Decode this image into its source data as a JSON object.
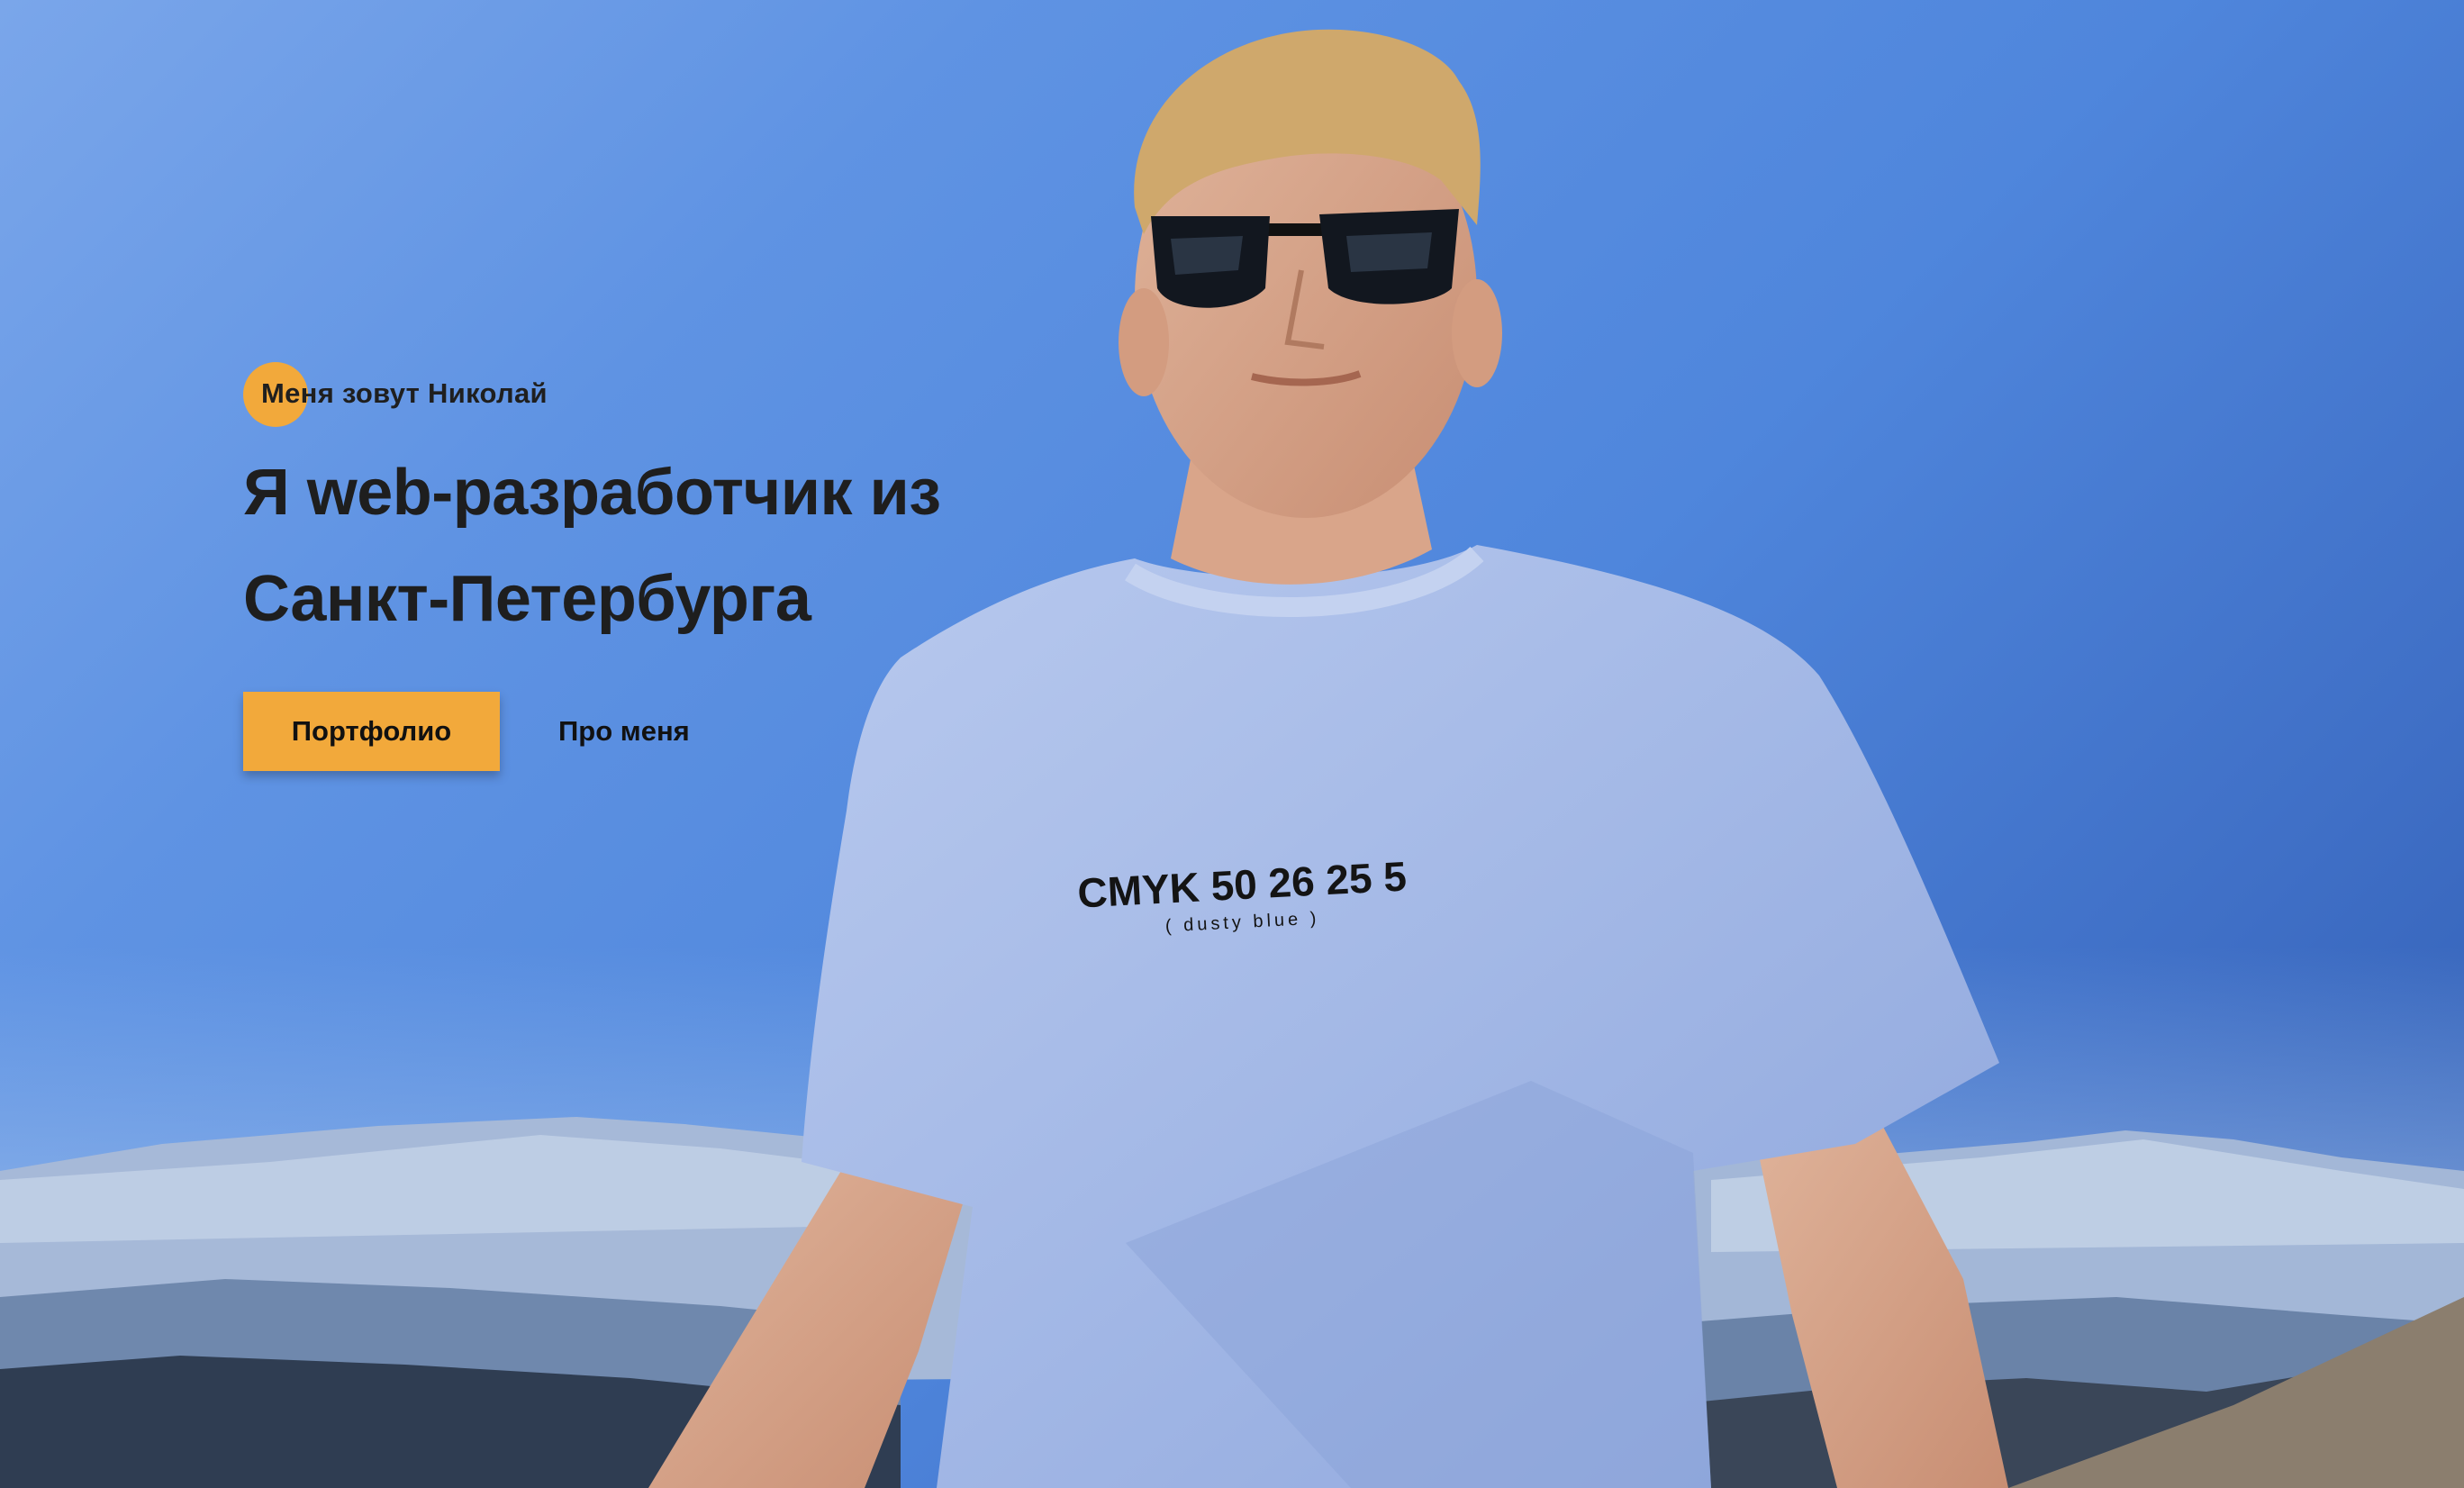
{
  "hero": {
    "eyebrow": "Меня зовут Николай",
    "headline_line1": "Я web-разработчик из",
    "headline_line2": "Санкт-Петербурга",
    "primary_button": "Портфолио",
    "secondary_link": "Про меня",
    "shirt_print_main": "CMYK 50 26 25 5",
    "shirt_print_sub": "( dusty blue )"
  },
  "colors": {
    "accent": "#f2a93b",
    "text": "#1e1e1e",
    "sky": "#4f86dc",
    "shirt": "#a9bde8"
  }
}
